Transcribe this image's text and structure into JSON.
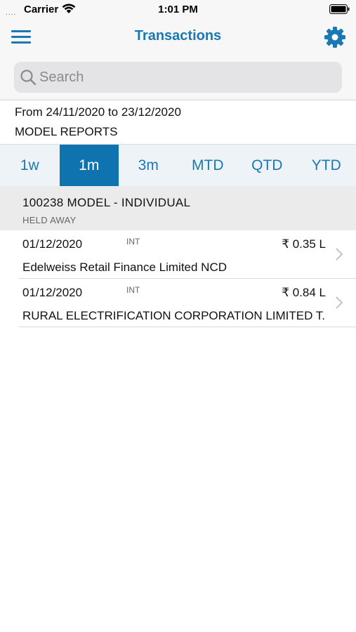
{
  "status_bar": {
    "carrier": "Carrier",
    "time": "1:01 PM",
    "signal": "....",
    "wifi_icon": "wifi-icon",
    "battery_icon": "battery-icon"
  },
  "nav": {
    "title": "Transactions",
    "menu_icon": "hamburger-menu-icon",
    "settings_icon": "gear-icon"
  },
  "search": {
    "placeholder": "Search",
    "value": ""
  },
  "info": {
    "date_range": "From 24/11/2020 to 23/12/2020",
    "report_name": "MODEL REPORTS"
  },
  "tabs": [
    {
      "label": "1w",
      "active": false
    },
    {
      "label": "1m",
      "active": true
    },
    {
      "label": "3m",
      "active": false
    },
    {
      "label": "MTD",
      "active": false
    },
    {
      "label": "QTD",
      "active": false
    },
    {
      "label": "YTD",
      "active": false
    }
  ],
  "group": {
    "title": "100238 MODEL - INDIVIDUAL",
    "subtitle": "HELD AWAY"
  },
  "transactions": [
    {
      "date": "01/12/2020",
      "type": "INT",
      "amount": "₹ 0.35 L",
      "name": "Edelweiss Retail Finance Limited NCD"
    },
    {
      "date": "01/12/2020",
      "type": "INT",
      "amount": "₹ 0.84 L",
      "name": "RURAL ELECTRIFICATION CORPORATION LIMITED T..."
    }
  ],
  "colors": {
    "accent": "#1a78b4",
    "active_tab_bg": "#0f73b0",
    "group_bg": "#ebebeb"
  }
}
